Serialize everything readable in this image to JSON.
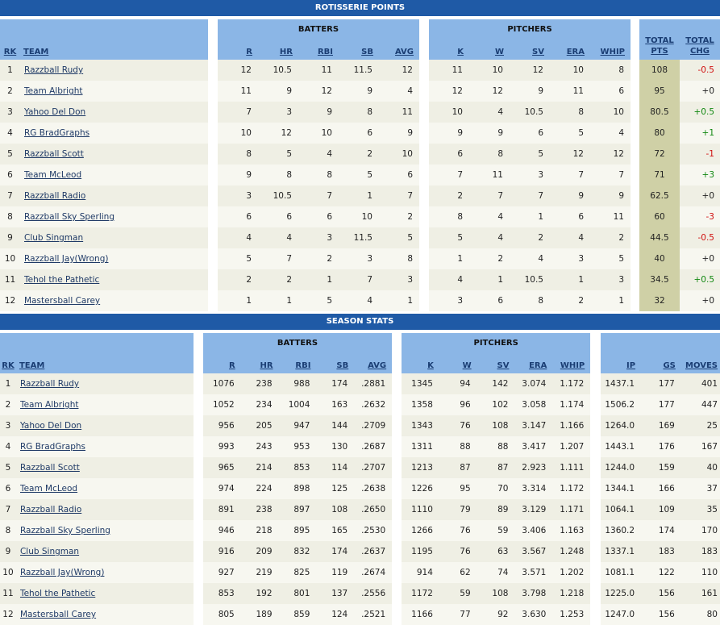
{
  "roto": {
    "title": "ROTISSERIE POINTS",
    "group_batters": "BATTERS",
    "group_pitchers": "PITCHERS",
    "columns": {
      "rk": "RK",
      "team": "TEAM",
      "r": "R",
      "hr": "HR",
      "rbi": "RBI",
      "sb": "SB",
      "avg": "AVG",
      "k": "K",
      "w": "W",
      "sv": "SV",
      "era": "ERA",
      "whip": "WHIP",
      "total_pts_1": "TOTAL",
      "total_pts_2": "PTS",
      "total_chg_1": "TOTAL",
      "total_chg_2": "CHG"
    },
    "rows": [
      {
        "rk": "1",
        "team": "Razzball Rudy",
        "r": "12",
        "hr": "10.5",
        "rbi": "11",
        "sb": "11.5",
        "avg": "12",
        "k": "11",
        "w": "10",
        "sv": "12",
        "era": "10",
        "whip": "8",
        "pts": "108",
        "chg": "-0.5"
      },
      {
        "rk": "2",
        "team": "Team Albright",
        "r": "11",
        "hr": "9",
        "rbi": "12",
        "sb": "9",
        "avg": "4",
        "k": "12",
        "w": "12",
        "sv": "9",
        "era": "11",
        "whip": "6",
        "pts": "95",
        "chg": "+0"
      },
      {
        "rk": "3",
        "team": "Yahoo Del Don",
        "r": "7",
        "hr": "3",
        "rbi": "9",
        "sb": "8",
        "avg": "11",
        "k": "10",
        "w": "4",
        "sv": "10.5",
        "era": "8",
        "whip": "10",
        "pts": "80.5",
        "chg": "+0.5"
      },
      {
        "rk": "4",
        "team": "RG BradGraphs",
        "r": "10",
        "hr": "12",
        "rbi": "10",
        "sb": "6",
        "avg": "9",
        "k": "9",
        "w": "9",
        "sv": "6",
        "era": "5",
        "whip": "4",
        "pts": "80",
        "chg": "+1"
      },
      {
        "rk": "5",
        "team": "Razzball Scott",
        "r": "8",
        "hr": "5",
        "rbi": "4",
        "sb": "2",
        "avg": "10",
        "k": "6",
        "w": "8",
        "sv": "5",
        "era": "12",
        "whip": "12",
        "pts": "72",
        "chg": "-1"
      },
      {
        "rk": "6",
        "team": "Team McLeod",
        "r": "9",
        "hr": "8",
        "rbi": "8",
        "sb": "5",
        "avg": "6",
        "k": "7",
        "w": "11",
        "sv": "3",
        "era": "7",
        "whip": "7",
        "pts": "71",
        "chg": "+3"
      },
      {
        "rk": "7",
        "team": "Razzball Radio",
        "r": "3",
        "hr": "10.5",
        "rbi": "7",
        "sb": "1",
        "avg": "7",
        "k": "2",
        "w": "7",
        "sv": "7",
        "era": "9",
        "whip": "9",
        "pts": "62.5",
        "chg": "+0"
      },
      {
        "rk": "8",
        "team": "Razzball Sky Sperling",
        "r": "6",
        "hr": "6",
        "rbi": "6",
        "sb": "10",
        "avg": "2",
        "k": "8",
        "w": "4",
        "sv": "1",
        "era": "6",
        "whip": "11",
        "pts": "60",
        "chg": "-3"
      },
      {
        "rk": "9",
        "team": "Club Singman",
        "r": "4",
        "hr": "4",
        "rbi": "3",
        "sb": "11.5",
        "avg": "5",
        "k": "5",
        "w": "4",
        "sv": "2",
        "era": "4",
        "whip": "2",
        "pts": "44.5",
        "chg": "-0.5"
      },
      {
        "rk": "10",
        "team": "Razzball Jay(Wrong)",
        "r": "5",
        "hr": "7",
        "rbi": "2",
        "sb": "3",
        "avg": "8",
        "k": "1",
        "w": "2",
        "sv": "4",
        "era": "3",
        "whip": "5",
        "pts": "40",
        "chg": "+0"
      },
      {
        "rk": "11",
        "team": "Tehol the Pathetic",
        "r": "2",
        "hr": "2",
        "rbi": "1",
        "sb": "7",
        "avg": "3",
        "k": "4",
        "w": "1",
        "sv": "10.5",
        "era": "1",
        "whip": "3",
        "pts": "34.5",
        "chg": "+0.5"
      },
      {
        "rk": "12",
        "team": "Mastersball Carey",
        "r": "1",
        "hr": "1",
        "rbi": "5",
        "sb": "4",
        "avg": "1",
        "k": "3",
        "w": "6",
        "sv": "8",
        "era": "2",
        "whip": "1",
        "pts": "32",
        "chg": "+0"
      }
    ]
  },
  "season": {
    "title": "SEASON STATS",
    "group_batters": "BATTERS",
    "group_pitchers": "PITCHERS",
    "columns": {
      "rk": "RK",
      "team": "TEAM",
      "r": "R",
      "hr": "HR",
      "rbi": "RBI",
      "sb": "SB",
      "avg": "AVG",
      "k": "K",
      "w": "W",
      "sv": "SV",
      "era": "ERA",
      "whip": "WHIP",
      "ip": "IP",
      "gs": "GS",
      "moves": "MOVES"
    },
    "rows": [
      {
        "rk": "1",
        "team": "Razzball Rudy",
        "r": "1076",
        "hr": "238",
        "rbi": "988",
        "sb": "174",
        "avg": ".2881",
        "k": "1345",
        "w": "94",
        "sv": "142",
        "era": "3.074",
        "whip": "1.172",
        "ip": "1437.1",
        "gs": "177",
        "moves": "401"
      },
      {
        "rk": "2",
        "team": "Team Albright",
        "r": "1052",
        "hr": "234",
        "rbi": "1004",
        "sb": "163",
        "avg": ".2632",
        "k": "1358",
        "w": "96",
        "sv": "102",
        "era": "3.058",
        "whip": "1.174",
        "ip": "1506.2",
        "gs": "177",
        "moves": "447"
      },
      {
        "rk": "3",
        "team": "Yahoo Del Don",
        "r": "956",
        "hr": "205",
        "rbi": "947",
        "sb": "144",
        "avg": ".2709",
        "k": "1343",
        "w": "76",
        "sv": "108",
        "era": "3.147",
        "whip": "1.166",
        "ip": "1264.0",
        "gs": "169",
        "moves": "25"
      },
      {
        "rk": "4",
        "team": "RG BradGraphs",
        "r": "993",
        "hr": "243",
        "rbi": "953",
        "sb": "130",
        "avg": ".2687",
        "k": "1311",
        "w": "88",
        "sv": "88",
        "era": "3.417",
        "whip": "1.207",
        "ip": "1443.1",
        "gs": "176",
        "moves": "167"
      },
      {
        "rk": "5",
        "team": "Razzball Scott",
        "r": "965",
        "hr": "214",
        "rbi": "853",
        "sb": "114",
        "avg": ".2707",
        "k": "1213",
        "w": "87",
        "sv": "87",
        "era": "2.923",
        "whip": "1.111",
        "ip": "1244.0",
        "gs": "159",
        "moves": "40"
      },
      {
        "rk": "6",
        "team": "Team McLeod",
        "r": "974",
        "hr": "224",
        "rbi": "898",
        "sb": "125",
        "avg": ".2638",
        "k": "1226",
        "w": "95",
        "sv": "70",
        "era": "3.314",
        "whip": "1.172",
        "ip": "1344.1",
        "gs": "166",
        "moves": "37"
      },
      {
        "rk": "7",
        "team": "Razzball Radio",
        "r": "891",
        "hr": "238",
        "rbi": "897",
        "sb": "108",
        "avg": ".2650",
        "k": "1110",
        "w": "79",
        "sv": "89",
        "era": "3.129",
        "whip": "1.171",
        "ip": "1064.1",
        "gs": "109",
        "moves": "35"
      },
      {
        "rk": "8",
        "team": "Razzball Sky Sperling",
        "r": "946",
        "hr": "218",
        "rbi": "895",
        "sb": "165",
        "avg": ".2530",
        "k": "1266",
        "w": "76",
        "sv": "59",
        "era": "3.406",
        "whip": "1.163",
        "ip": "1360.2",
        "gs": "174",
        "moves": "170"
      },
      {
        "rk": "9",
        "team": "Club Singman",
        "r": "916",
        "hr": "209",
        "rbi": "832",
        "sb": "174",
        "avg": ".2637",
        "k": "1195",
        "w": "76",
        "sv": "63",
        "era": "3.567",
        "whip": "1.248",
        "ip": "1337.1",
        "gs": "183",
        "moves": "183"
      },
      {
        "rk": "10",
        "team": "Razzball Jay(Wrong)",
        "r": "927",
        "hr": "219",
        "rbi": "825",
        "sb": "119",
        "avg": ".2674",
        "k": "914",
        "w": "62",
        "sv": "74",
        "era": "3.571",
        "whip": "1.202",
        "ip": "1081.1",
        "gs": "122",
        "moves": "110"
      },
      {
        "rk": "11",
        "team": "Tehol the Pathetic",
        "r": "853",
        "hr": "192",
        "rbi": "801",
        "sb": "137",
        "avg": ".2556",
        "k": "1172",
        "w": "59",
        "sv": "108",
        "era": "3.798",
        "whip": "1.218",
        "ip": "1225.0",
        "gs": "156",
        "moves": "161"
      },
      {
        "rk": "12",
        "team": "Mastersball Carey",
        "r": "805",
        "hr": "189",
        "rbi": "859",
        "sb": "124",
        "avg": ".2521",
        "k": "1166",
        "w": "77",
        "sv": "92",
        "era": "3.630",
        "whip": "1.253",
        "ip": "1247.0",
        "gs": "156",
        "moves": "80"
      }
    ]
  }
}
